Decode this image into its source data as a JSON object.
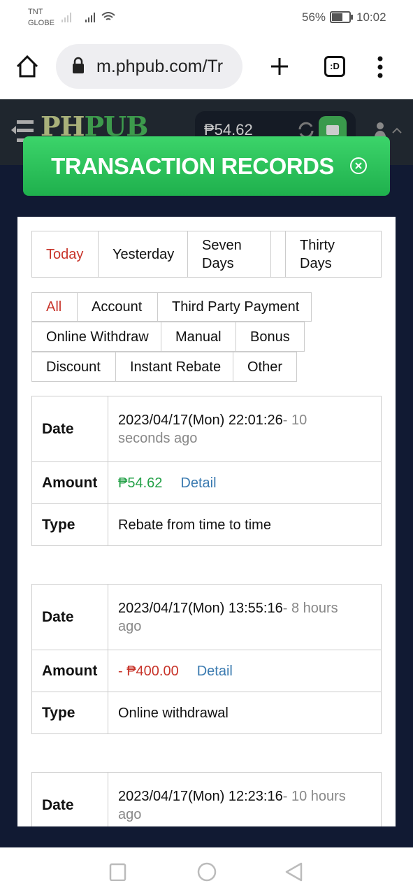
{
  "status_bar": {
    "carrier_1": "TNT",
    "carrier_2": "GLOBE",
    "battery": "56%",
    "time": "10:02"
  },
  "browser": {
    "url": "m.phpub.com/Tr",
    "tab_icon_label": ":D"
  },
  "header": {
    "logo_part1": "PH",
    "logo_part2": "PUB",
    "balance": "₱54.62"
  },
  "banner": {
    "title": "TRANSACTION RECORDS"
  },
  "period_tabs": [
    {
      "label": "Today",
      "active": true
    },
    {
      "label": "Yesterday"
    },
    {
      "label": "Seven Days"
    },
    {
      "label": "Thirty Days"
    }
  ],
  "type_filters": [
    {
      "label": "All",
      "active": true
    },
    {
      "label": "Account"
    },
    {
      "label": "Third Party Payment"
    },
    {
      "label": "Online Withdraw"
    },
    {
      "label": "Manual"
    },
    {
      "label": "Bonus"
    },
    {
      "label": "Discount"
    },
    {
      "label": "Instant Rebate"
    },
    {
      "label": "Other"
    }
  ],
  "labels": {
    "date": "Date",
    "amount": "Amount",
    "type": "Type",
    "detail": "Detail"
  },
  "records": [
    {
      "date": "2023/04/17(Mon) 22:01:26",
      "ago": "- 10 seconds ago",
      "amount": "₱54.62",
      "type": "Rebate from time to time",
      "positive": true
    },
    {
      "date": "2023/04/17(Mon) 13:55:16",
      "ago": "- 8 hours ago",
      "amount": "- ₱400.00",
      "type": "Online withdrawal",
      "positive": false
    },
    {
      "date": "2023/04/17(Mon) 12:23:16",
      "ago": "- 10 hours ago"
    }
  ],
  "colors": {
    "accent_green": "#2ec45b",
    "negative_red": "#c8342a",
    "positive_green": "#24a148",
    "link_blue": "#3a7ab0",
    "page_bg": "#111a33"
  }
}
